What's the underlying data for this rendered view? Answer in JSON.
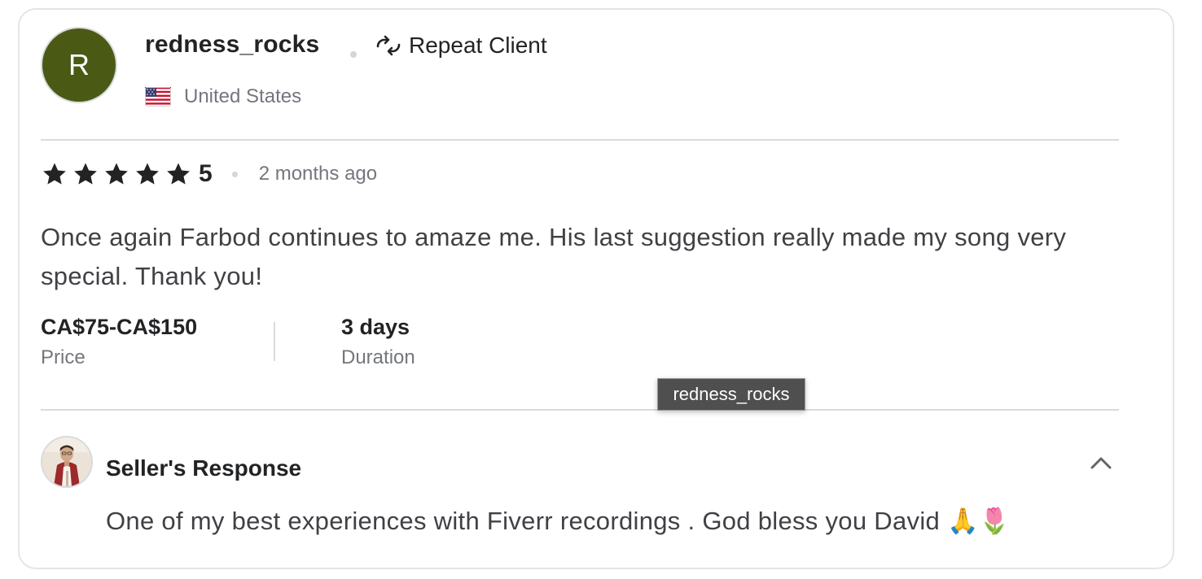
{
  "reviewer": {
    "avatar_initial": "R",
    "avatar_color": "#4a5a15",
    "username": "redness_rocks",
    "badge_icon": "repeat-icon",
    "badge_label": "Repeat Client",
    "country_flag": "us-flag-icon",
    "country": "United States"
  },
  "review": {
    "stars": 5,
    "rating_value": "5",
    "time_ago": "2 months ago",
    "text": "Once again Farbod continues to amaze me. His last suggestion really made my song very special. Thank you!"
  },
  "meta": {
    "price_value": "CA$75-CA$150",
    "price_label": "Price",
    "duration_value": "3 days",
    "duration_label": "Duration"
  },
  "tooltip": {
    "text": "redness_rocks"
  },
  "seller_response": {
    "title": "Seller's Response",
    "text": "One of my best experiences with Fiverr recordings . God bless you David 🙏🌷",
    "collapse_icon": "chevron-up-icon"
  },
  "colors": {
    "text_primary": "#222325",
    "text_secondary": "#74767e",
    "divider": "#dadbdd",
    "star": "#222325"
  }
}
